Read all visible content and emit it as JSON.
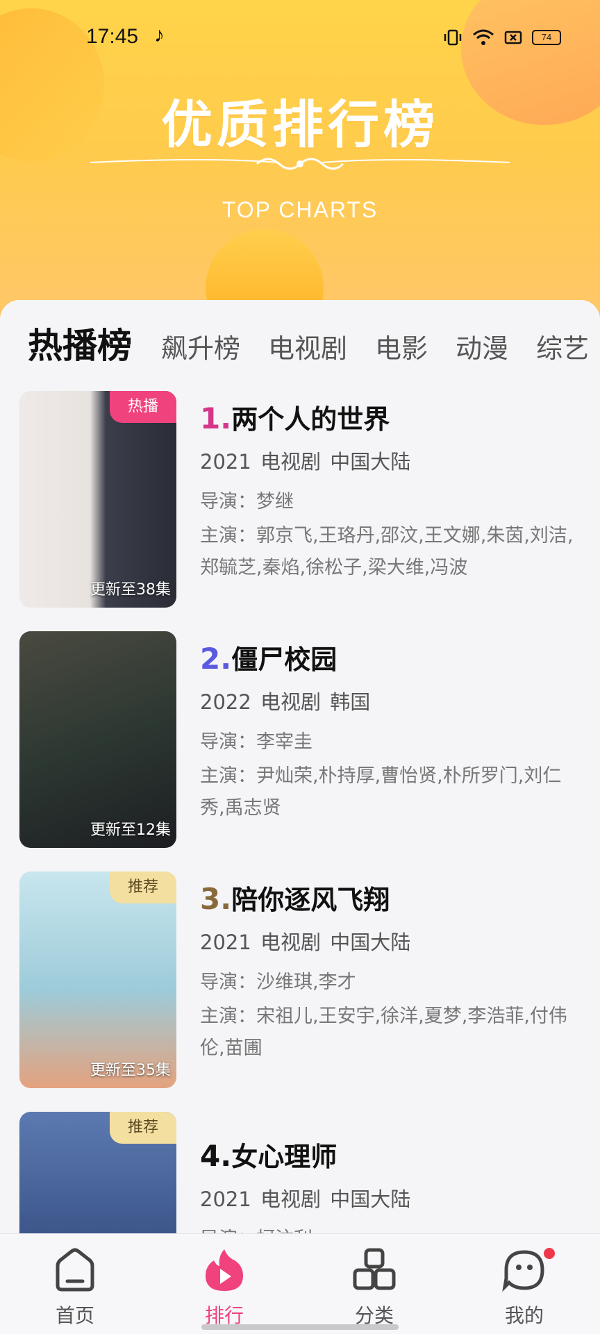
{
  "status_bar": {
    "time": "17:45",
    "battery": "74"
  },
  "hero": {
    "title": "优质排行榜",
    "subtitle": "TOP CHARTS"
  },
  "tabs": [
    "热播榜",
    "飙升榜",
    "电视剧",
    "电影",
    "动漫",
    "综艺"
  ],
  "items": [
    {
      "rank": "1.",
      "rank_color": "#d6368a",
      "title": "两个人的世界",
      "meta": "2021  电视剧  中国大陆",
      "director": "导演：梦继",
      "cast": "主演：郭京飞,王珞丹,邵汶,王文娜,朱茵,刘洁,郑毓芝,秦焰,徐松子,梁大维,冯波",
      "badge": "热播",
      "update": "更新至38集"
    },
    {
      "rank": "2.",
      "rank_color": "#5a5ae0",
      "title": "僵尸校园",
      "meta": "2022  电视剧  韩国",
      "director": "导演：李宰圭",
      "cast": "主演：尹灿荣,朴持厚,曹怡贤,朴所罗门,刘仁秀,禹志贤",
      "badge": "",
      "update": "更新至12集"
    },
    {
      "rank": "3.",
      "rank_color": "#8a6a3a",
      "title": "陪你逐风飞翔",
      "meta": "2021  电视剧  中国大陆",
      "director": "导演：沙维琪,李才",
      "cast": "主演：宋祖儿,王安宇,徐洋,夏梦,李浩菲,付伟伦,苗圃",
      "badge": "推荐",
      "update": "更新至35集"
    },
    {
      "rank": "4.",
      "rank_color": "#111111",
      "title": "女心理师",
      "meta": "2021  电视剧  中国大陆",
      "director": "导演：柯汶利",
      "cast": "",
      "badge": "推荐",
      "update": ""
    }
  ],
  "nav": [
    {
      "label": "首页",
      "icon": "home-icon"
    },
    {
      "label": "排行",
      "icon": "flame-play-icon"
    },
    {
      "label": "分类",
      "icon": "category-icon"
    },
    {
      "label": "我的",
      "icon": "profile-icon"
    }
  ],
  "colors": {
    "accent": "#f0427d",
    "hero": "#ffd44a"
  }
}
